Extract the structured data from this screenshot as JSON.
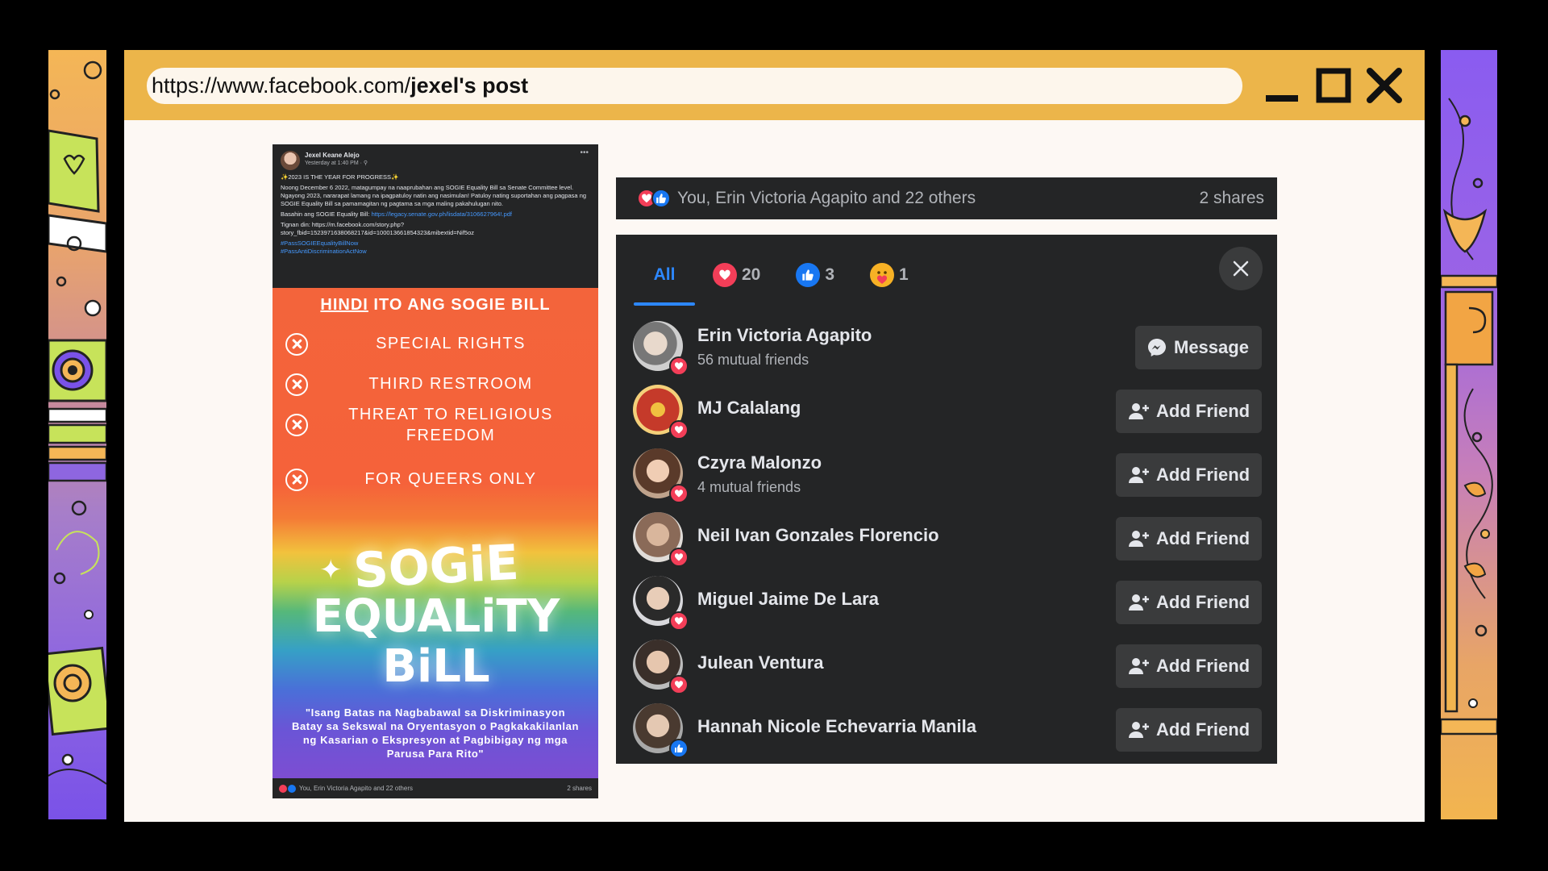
{
  "browser": {
    "url_prefix": "https://www.facebook.com/",
    "url_path": "jexel's post"
  },
  "post": {
    "author": "Jexel Keane Alejo",
    "time": "Yesterday at 1:40 PM · ⚲",
    "headline": "✨2023 IS THE YEAR FOR PROGRESS✨",
    "body": "Noong December 6 2022, matagumpay na naaprubahan ang SOGIE Equality Bill sa Senate Committee level. Ngayong 2023, nararapat lamang na ipagpatuloy natin ang nasimulan! Patuloy nating suportahan ang pagpasa ng SOGIE Equality Bill sa pamamagitan ng pagtama sa mga maling pakahulugan nito.",
    "read_label": "Basahin ang SOGIE Equality Bill:",
    "read_link": "https://legacy.senate.gov.ph/lisdata/3106627964!.pdf",
    "see_also": "Tignan din: https://m.facebook.com/story.php?story_fbid=1523971638068217&id=100013661854323&mibextid=Nif5oz",
    "hashtag1": "#PassSOGIEEqualityBillNow",
    "hashtag2": "#PassAntiDiscriminationActNow",
    "footer_reactions": "You, Erin Victoria Agapito and 22 others",
    "footer_shares": "2 shares"
  },
  "poster": {
    "title_underlined": "HINDI",
    "title_rest": " ITO ANG SOGIE BILL",
    "items": [
      "SPECIAL RIGHTS",
      "THIRD RESTROOM",
      "THREAT TO RELIGIOUS FREEDOM",
      "FOR QUEERS ONLY"
    ],
    "logo_line1": "SOGiE",
    "logo_line2": "EQUALiTY",
    "logo_line3": "BiLL",
    "quote": "\"Isang Batas na Nagbabawal sa Diskriminasyon Batay sa Sekswal na Oryentasyon o Pagkakakilanlan ng Kasarian o Ekspresyon at Pagbibigay ng mga Parusa Para Rito\""
  },
  "summary": {
    "names": "You, Erin Victoria Agapito and 22 others",
    "shares": "2 shares"
  },
  "tabs": {
    "all": "All",
    "love_count": "20",
    "like_count": "3",
    "care_count": "1"
  },
  "people": [
    {
      "name": "Erin Victoria Agapito",
      "mutual": "56 mutual friends",
      "reaction": "love",
      "action": "Message"
    },
    {
      "name": "MJ Calalang",
      "mutual": "",
      "reaction": "love",
      "action": "Add Friend"
    },
    {
      "name": "Czyra Malonzo",
      "mutual": "4 mutual friends",
      "reaction": "love",
      "action": "Add Friend"
    },
    {
      "name": "Neil Ivan Gonzales Florencio",
      "mutual": "",
      "reaction": "love",
      "action": "Add Friend"
    },
    {
      "name": "Miguel Jaime De Lara",
      "mutual": "",
      "reaction": "love",
      "action": "Add Friend"
    },
    {
      "name": "Julean Ventura",
      "mutual": "",
      "reaction": "love",
      "action": "Add Friend"
    },
    {
      "name": "Hannah Nicole Echevarria Manila",
      "mutual": "",
      "reaction": "like",
      "action": "Add Friend"
    }
  ],
  "colors": {
    "window_bar": "#ecb54a",
    "dialog_bg": "#242526",
    "button_bg": "#3a3b3c",
    "accent_blue": "#2d88ff",
    "love": "#f33e58",
    "like": "#1877f2",
    "care": "#f7b125"
  }
}
